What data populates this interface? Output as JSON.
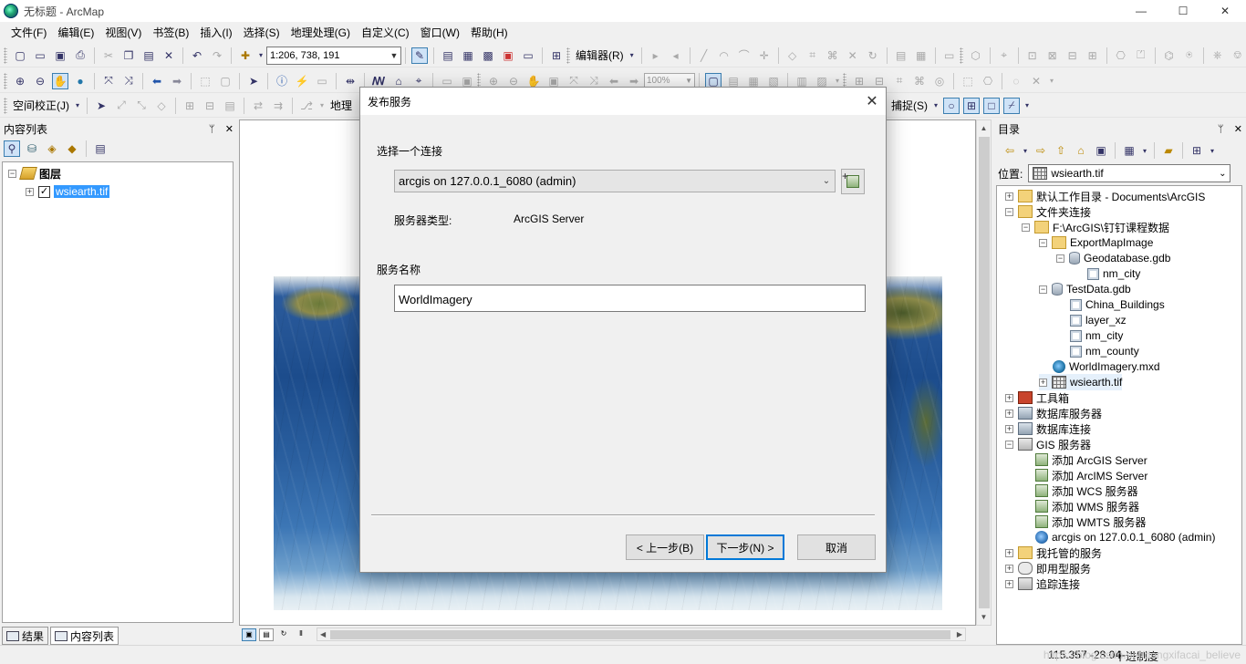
{
  "window": {
    "title": "无标题 - ArcMap",
    "minimize": "—",
    "maximize": "☐",
    "close": "✕"
  },
  "menu": [
    "文件(F)",
    "编辑(E)",
    "视图(V)",
    "书签(B)",
    "插入(I)",
    "选择(S)",
    "地理处理(G)",
    "自定义(C)",
    "窗口(W)",
    "帮助(H)"
  ],
  "toolbar": {
    "scale": "1:206, 738, 191",
    "editor_label": "编辑器(R)",
    "zoom_percent": "100%",
    "georef_label": "空间校正(J)",
    "geoproc_label": "地理",
    "snapping_label": "捕捉(S)"
  },
  "toc": {
    "title": "内容列表",
    "pin": "ᛘ",
    "close": "✕",
    "root_label": "图层",
    "layer_label": "wsiearth.tif",
    "layer_checked": true,
    "tab_results": "结果",
    "tab_toc": "内容列表"
  },
  "catalog": {
    "title": "目录",
    "location_label": "位置:",
    "location_value": "wsiearth.tif",
    "items": {
      "default_dir": "默认工作目录 - Documents\\ArcGIS",
      "folder_connections": "文件夹连接",
      "folder_path": "F:\\ArcGIS\\钉钉课程数据",
      "export_map_image": "ExportMapImage",
      "geodatabase": "Geodatabase.gdb",
      "nm_city_1": "nm_city",
      "testdata": "TestData.gdb",
      "china_buildings": "China_Buildings",
      "layer_xz": "layer_xz",
      "nm_city_2": "nm_city",
      "nm_county": "nm_county",
      "world_mxd": "WorldImagery.mxd",
      "wsiearth": "wsiearth.tif",
      "toolbox": "工具箱",
      "db_servers": "数据库服务器",
      "db_connections": "数据库连接",
      "gis_servers": "GIS 服务器",
      "add_arcgis": "添加 ArcGIS Server",
      "add_arcims": "添加 ArcIMS Server",
      "add_wcs": "添加 WCS 服务器",
      "add_wms": "添加 WMS 服务器",
      "add_wmts": "添加 WMTS 服务器",
      "arcgis_conn": "arcgis on 127.0.0.1_6080 (admin)",
      "hosted": "我托管的服务",
      "ready": "即用型服务",
      "tracking": "追踪连接"
    }
  },
  "dialog": {
    "title": "发布服务",
    "choose_connection_label": "选择一个连接",
    "connection_value": "arcgis on 127.0.0.1_6080 (admin)",
    "server_type_label": "服务器类型:",
    "server_type_value": "ArcGIS Server",
    "service_name_label": "服务名称",
    "service_name_value": "WorldImagery",
    "back_button": "< 上一步(B)",
    "next_button": "下一步(N) >",
    "cancel_button": "取消"
  },
  "status": {
    "coords": "115.357  -28.04",
    "units": "十进制度",
    "watermark": "https://blog.csdn.net/dongxifacai_believe"
  }
}
